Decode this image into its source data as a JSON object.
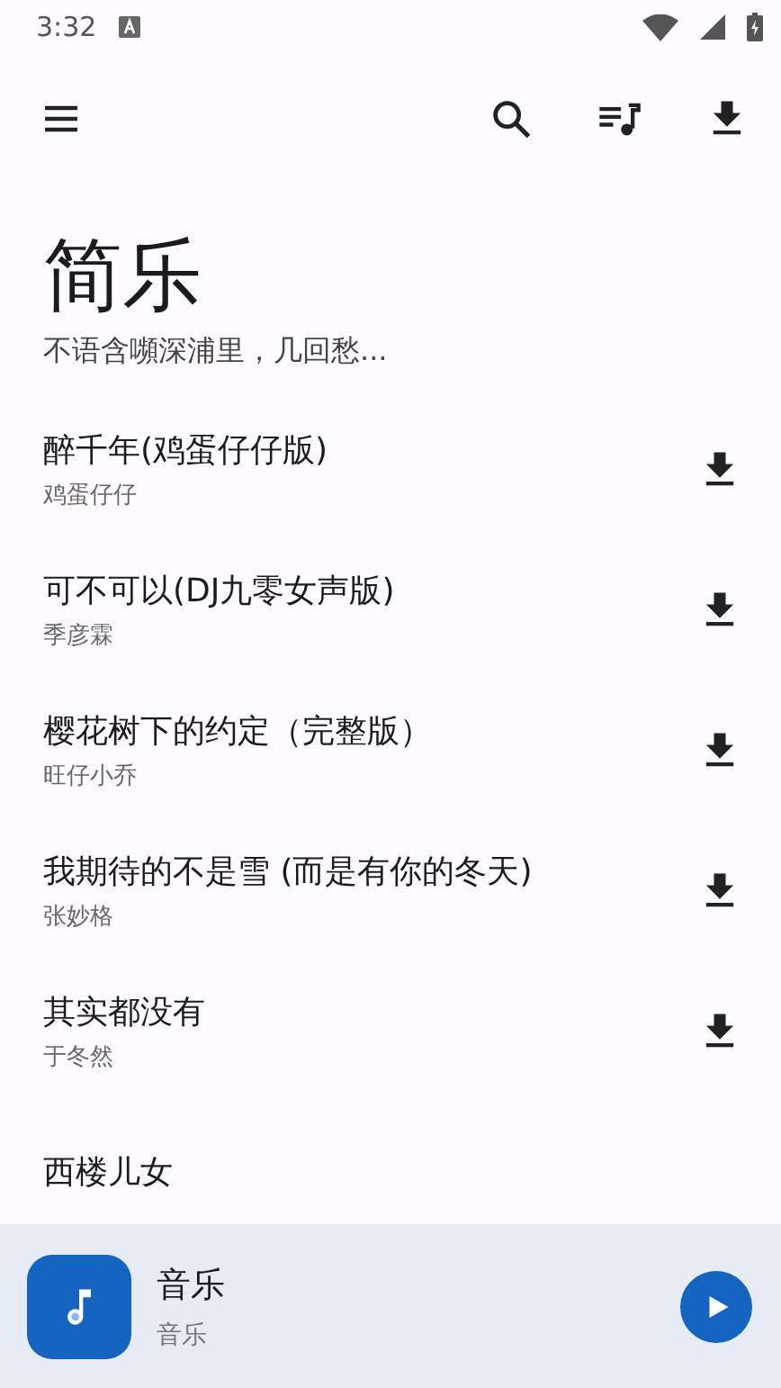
{
  "status_bar": {
    "time": "3:32"
  },
  "header": {
    "title": "简乐",
    "subtitle": "不语含嚬深浦里，几回愁..."
  },
  "songs": [
    {
      "title": "醉千年(鸡蛋仔仔版)",
      "artist": "鸡蛋仔仔"
    },
    {
      "title": "可不可以(DJ九零女声版)",
      "artist": "季彦霖"
    },
    {
      "title": "樱花树下的约定（完整版）",
      "artist": "旺仔小乔"
    },
    {
      "title": "我期待的不是雪 (而是有你的冬天)",
      "artist": "张妙格"
    },
    {
      "title": "其实都没有",
      "artist": "于冬然"
    },
    {
      "title": "西楼儿女"
    }
  ],
  "player": {
    "title": "音乐",
    "subtitle": "音乐"
  }
}
